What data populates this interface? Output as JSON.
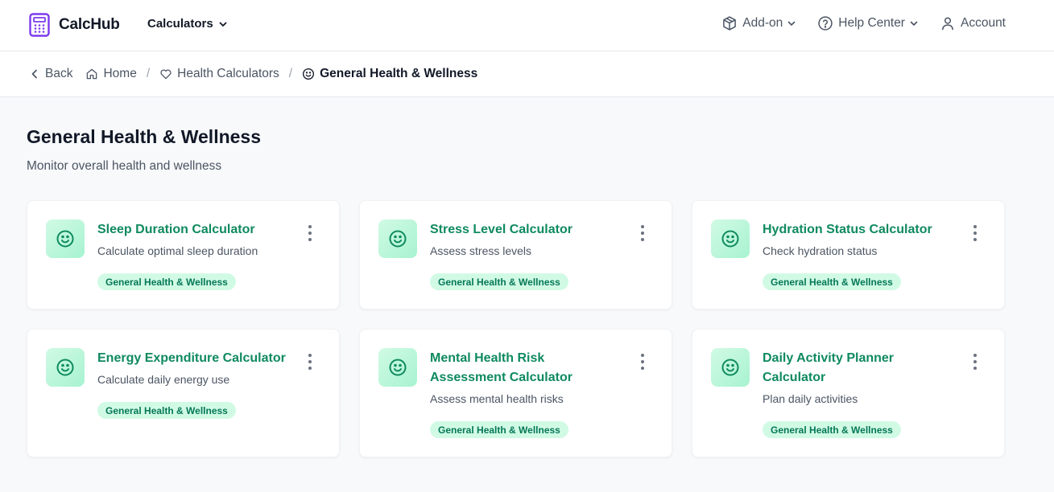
{
  "app": {
    "name": "CalcHub"
  },
  "header": {
    "calculators_label": "Calculators",
    "addon_label": "Add-on",
    "help_label": "Help Center",
    "account_label": "Account"
  },
  "breadcrumb": {
    "back": "Back",
    "home": "Home",
    "parent": "Health Calculators",
    "current": "General Health & Wellness",
    "separator": "/"
  },
  "page": {
    "title": "General Health & Wellness",
    "subtitle": "Monitor overall health and wellness"
  },
  "colors": {
    "brand": "#7c3aed",
    "accent": "#0f8a5f",
    "tag_bg": "#d1fae5"
  },
  "cards": [
    {
      "title": "Sleep Duration Calculator",
      "description": "Calculate optimal sleep duration",
      "tag": "General Health & Wellness",
      "icon": "smile-icon"
    },
    {
      "title": "Stress Level Calculator",
      "description": "Assess stress levels",
      "tag": "General Health & Wellness",
      "icon": "smile-icon"
    },
    {
      "title": "Hydration Status Calculator",
      "description": "Check hydration status",
      "tag": "General Health & Wellness",
      "icon": "smile-icon"
    },
    {
      "title": "Energy Expenditure Calculator",
      "description": "Calculate daily energy use",
      "tag": "General Health & Wellness",
      "icon": "smile-icon"
    },
    {
      "title": "Mental Health Risk Assessment Calculator",
      "description": "Assess mental health risks",
      "tag": "General Health & Wellness",
      "icon": "smile-icon"
    },
    {
      "title": "Daily Activity Planner Calculator",
      "description": "Plan daily activities",
      "tag": "General Health & Wellness",
      "icon": "smile-icon"
    }
  ]
}
